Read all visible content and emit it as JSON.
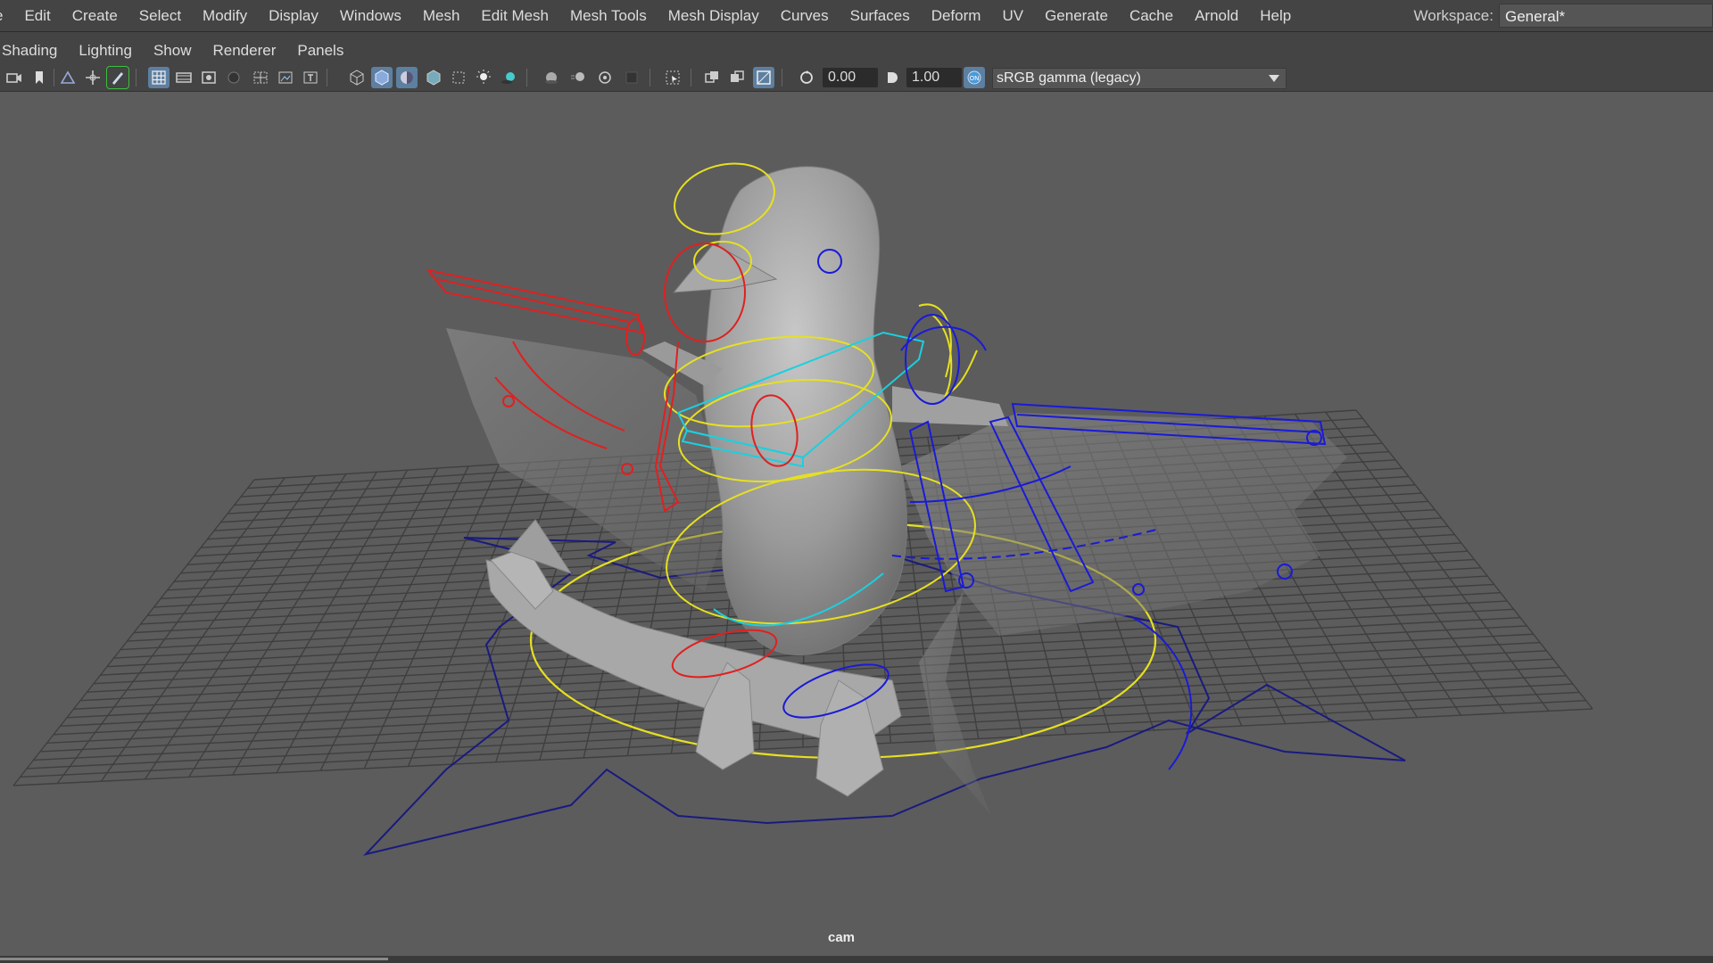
{
  "menubar": {
    "items": [
      "e",
      "Edit",
      "Create",
      "Select",
      "Modify",
      "Display",
      "Windows",
      "Mesh",
      "Edit Mesh",
      "Mesh Tools",
      "Mesh Display",
      "Curves",
      "Surfaces",
      "Deform",
      "UV",
      "Generate",
      "Cache",
      "Arnold",
      "Help"
    ],
    "workspace_label": "Workspace:",
    "workspace_value": "General*"
  },
  "panelbar": {
    "items": [
      "Shading",
      "Lighting",
      "Show",
      "Renderer",
      "Panels"
    ]
  },
  "toolbar": {
    "exposure_value": "0.00",
    "gamma_value": "1.00",
    "color_space": "sRGB gamma (legacy)"
  },
  "viewport": {
    "camera_label": "cam"
  },
  "colors": {
    "left_controls": "#e02020",
    "right_controls": "#1a1ad8",
    "center_controls": "#e6e020",
    "cyan_controls": "#1ad0e0",
    "ground_grid": "#3a3a3a",
    "viewport_bg": "#5c5c5c"
  }
}
